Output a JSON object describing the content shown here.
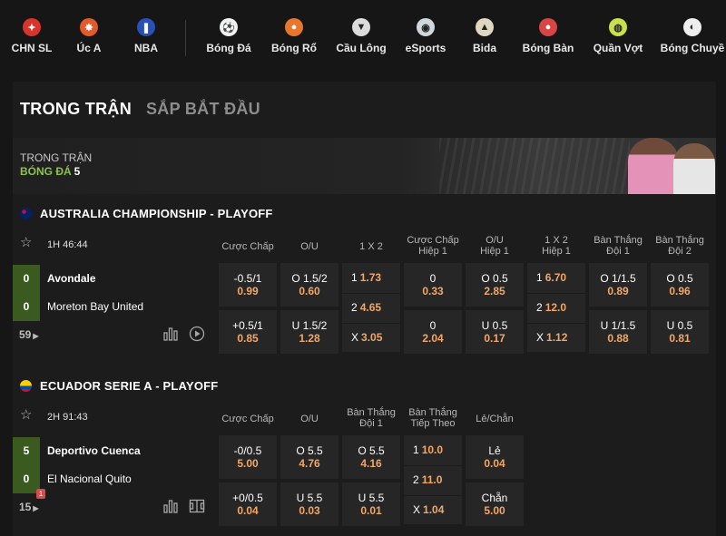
{
  "nav": {
    "items": [
      {
        "label": "CHN SL",
        "icon": "chn-sl-logo-icon",
        "color": "#d9342b"
      },
      {
        "label": "Úc A",
        "icon": "a-league-logo-icon",
        "color": "#e2592a"
      },
      {
        "label": "NBA",
        "icon": "nba-logo-icon",
        "color": "#2a4fb8"
      },
      {
        "label": "Bóng Đá",
        "icon": "soccer-ball-icon",
        "color": "#f2f2f2"
      },
      {
        "label": "Bóng Rổ",
        "icon": "basketball-icon",
        "color": "#e8772e"
      },
      {
        "label": "Cầu Lông",
        "icon": "shuttlecock-icon",
        "color": "#dcdcdc"
      },
      {
        "label": "eSports",
        "icon": "gamepad-icon",
        "color": "#cfd8dc"
      },
      {
        "label": "Bida",
        "icon": "billiards-icon",
        "color": "#e0d7c0"
      },
      {
        "label": "Bóng Bàn",
        "icon": "ping-pong-icon",
        "color": "#d84545"
      },
      {
        "label": "Quần Vợt",
        "icon": "tennis-icon",
        "color": "#c8e04a"
      },
      {
        "label": "Bóng Chuyề",
        "icon": "volleyball-icon",
        "color": "#eeeeee"
      }
    ]
  },
  "tabs": {
    "live": "TRONG TRẬN",
    "upcoming": "SẮP BẮT ĐẦU"
  },
  "banner": {
    "subtitle": "TRONG TRẬN",
    "sport": "BÓNG ĐÁ",
    "count": "5"
  },
  "colors": {
    "odd": "#f0a76a",
    "score_bg": "#3b5a1f",
    "cell_bg": "#262626",
    "green": "#8bc34a"
  },
  "leagues": [
    {
      "title": "AUSTRALIA CHAMPIONSHIP - PLAYOFF",
      "flag": "australia-flag-icon",
      "time": "1H 46:44",
      "home": {
        "score": "0",
        "name": "Avondale"
      },
      "away": {
        "score": "0",
        "name": "Moreton Bay United"
      },
      "more": "59",
      "headers": [
        [
          "Cược Chấp"
        ],
        [
          "O/U"
        ],
        [
          "1 X 2"
        ],
        [
          "Cược Chấp",
          "Hiệp 1"
        ],
        [
          "O/U",
          "Hiệp 1"
        ],
        [
          "1 X 2",
          "Hiệp 1"
        ],
        [
          "Bàn Thắng",
          "Đội 1"
        ],
        [
          "Bàn Thắng",
          "Đội 2"
        ]
      ],
      "cells": [
        {
          "type": "pair",
          "rows": [
            {
              "top": "-0.5/1",
              "odd": "0.99"
            },
            {
              "top": "+0.5/1",
              "odd": "0.85"
            }
          ]
        },
        {
          "type": "pair",
          "rows": [
            {
              "top": "O 1.5/2",
              "odd": "0.60"
            },
            {
              "top": "U 1.5/2",
              "odd": "1.28"
            }
          ]
        },
        {
          "type": "triple",
          "rows": [
            {
              "k": "1",
              "v": "1.73"
            },
            {
              "k": "2",
              "v": "4.65"
            },
            {
              "k": "X",
              "v": "3.05"
            }
          ]
        },
        {
          "type": "pair",
          "rows": [
            {
              "top": "0",
              "odd": "0.33"
            },
            {
              "top": "0",
              "odd": "2.04"
            }
          ]
        },
        {
          "type": "pair",
          "rows": [
            {
              "top": "O 0.5",
              "odd": "2.85"
            },
            {
              "top": "U 0.5",
              "odd": "0.17"
            }
          ]
        },
        {
          "type": "triple2",
          "rows": [
            {
              "k": "1",
              "v": "6.70"
            },
            {
              "k": "2",
              "v": "12.0"
            },
            {
              "k": "X",
              "v": "1.12"
            }
          ]
        },
        {
          "type": "pair",
          "rows": [
            {
              "top": "O 1/1.5",
              "odd": "0.89"
            },
            {
              "top": "U 1/1.5",
              "odd": "0.88"
            }
          ]
        },
        {
          "type": "pair",
          "rows": [
            {
              "top": "O 0.5",
              "odd": "0.96"
            },
            {
              "top": "U 0.5",
              "odd": "0.81"
            }
          ]
        }
      ]
    },
    {
      "title": "ECUADOR SERIE A - PLAYOFF",
      "flag": "ecuador-flag-icon",
      "time": "2H 91:43",
      "home": {
        "score": "5",
        "name": "Deportivo Cuenca"
      },
      "away": {
        "score": "0",
        "name": "El Nacional Quito"
      },
      "red_card": "1",
      "more": "15",
      "headers": [
        [
          "Cược Chấp"
        ],
        [
          "O/U"
        ],
        [
          "Bàn Thắng",
          "Đội 1"
        ],
        [
          "Bàn Thắng",
          "Tiếp Theo"
        ],
        [
          "Lẻ/Chẵn"
        ]
      ],
      "cells": [
        {
          "type": "pair",
          "rows": [
            {
              "top": "-0/0.5",
              "odd": "5.00"
            },
            {
              "top": "+0/0.5",
              "odd": "0.04"
            }
          ]
        },
        {
          "type": "pair",
          "rows": [
            {
              "top": "O 5.5",
              "odd": "4.76"
            },
            {
              "top": "U 5.5",
              "odd": "0.03"
            }
          ]
        },
        {
          "type": "pair",
          "rows": [
            {
              "top": "O 5.5",
              "odd": "4.16"
            },
            {
              "top": "U 5.5",
              "odd": "0.01"
            }
          ]
        },
        {
          "type": "triple",
          "rows": [
            {
              "k": "1",
              "v": "10.0"
            },
            {
              "k": "2",
              "v": "11.0"
            },
            {
              "k": "X",
              "v": "1.04"
            }
          ]
        },
        {
          "type": "pair",
          "rows": [
            {
              "top": "Lẻ",
              "odd": "0.04"
            },
            {
              "top": "Chẵn",
              "odd": "5.00"
            }
          ]
        }
      ]
    }
  ]
}
